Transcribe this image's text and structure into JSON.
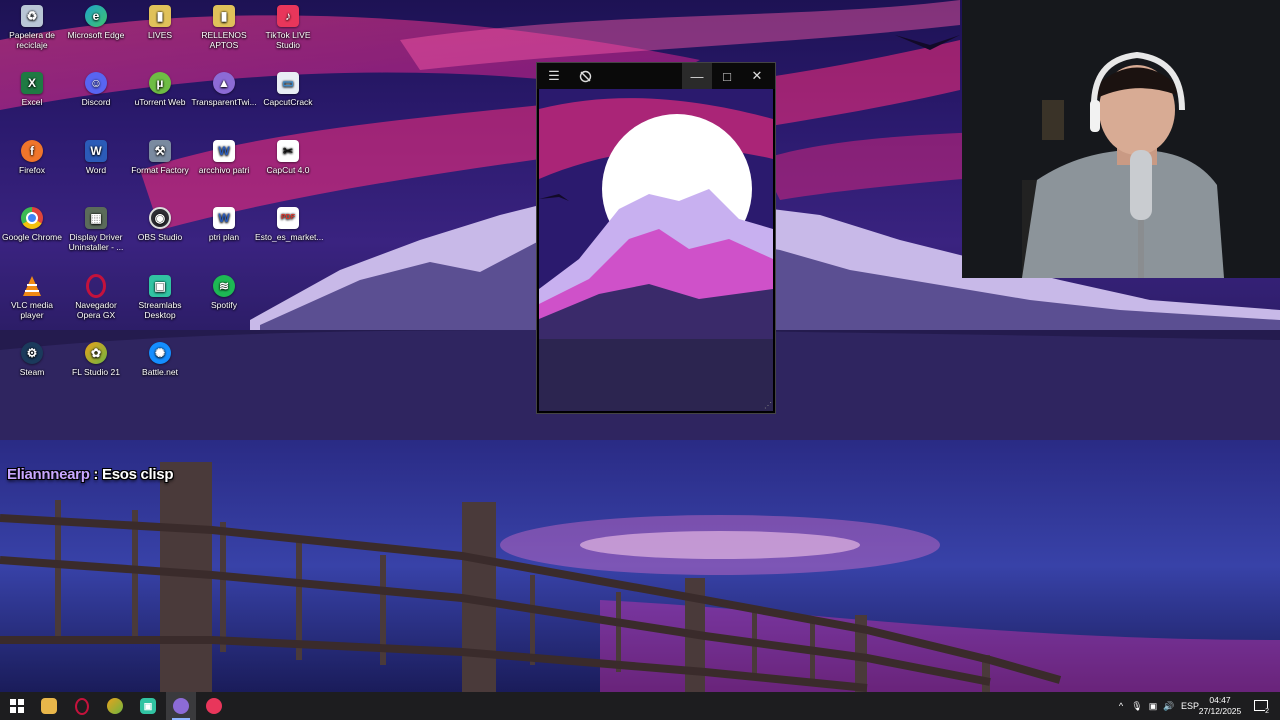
{
  "desktop": {
    "icons": [
      {
        "label": "Papelera de reciclaje",
        "icon": "recycle-bin-icon",
        "color": "#b9c6d6"
      },
      {
        "label": "Microsoft Edge",
        "icon": "edge-icon",
        "color": "#1fa3c9"
      },
      {
        "label": "LIVES",
        "icon": "folder-icon",
        "color": "#e0c15a"
      },
      {
        "label": "RELLENOS APTOS",
        "icon": "folder-icon",
        "color": "#e0c15a"
      },
      {
        "label": "TikTok LIVE Studio",
        "icon": "tiktok-live-icon",
        "color": "#e8365b"
      },
      {
        "label": "Excel",
        "icon": "excel-icon",
        "color": "#1f7a43"
      },
      {
        "label": "Discord",
        "icon": "discord-icon",
        "color": "#5865f2"
      },
      {
        "label": "uTorrent Web",
        "icon": "utorrent-icon",
        "color": "#6ebd44"
      },
      {
        "label": "TransparentTwi...",
        "icon": "twitch-icon",
        "color": "#8c6bd6"
      },
      {
        "label": "CapcutCrack",
        "icon": "app-icon",
        "color": "#3e8ed0"
      },
      {
        "label": "Firefox",
        "icon": "firefox-icon",
        "color": "#f0752b"
      },
      {
        "label": "Word",
        "icon": "word-icon",
        "color": "#2b5bb8"
      },
      {
        "label": "Format Factory",
        "icon": "format-factory-icon",
        "color": "#7a8aa0"
      },
      {
        "label": "arcchivo patri",
        "icon": "word-doc-icon",
        "color": "#2b5bb8"
      },
      {
        "label": "CapCut 4.0",
        "icon": "capcut-icon",
        "color": "#111111"
      },
      {
        "label": "Google Chrome",
        "icon": "chrome-icon",
        "color": "#e0443a"
      },
      {
        "label": "Display Driver Uninstaller - ...",
        "icon": "ddu-icon",
        "color": "#5b6b5a"
      },
      {
        "label": "OBS Studio",
        "icon": "obs-icon",
        "color": "#2d2d33"
      },
      {
        "label": "ptri plan",
        "icon": "word-doc-icon",
        "color": "#2b5bb8"
      },
      {
        "label": "Esto_es_market...",
        "icon": "pdf-icon",
        "color": "#d9352b"
      },
      {
        "label": "VLC media player",
        "icon": "vlc-icon",
        "color": "#f08a14"
      },
      {
        "label": "Navegador Opera GX",
        "icon": "opera-gx-icon",
        "color": "#c4123c"
      },
      {
        "label": "Streamlabs Desktop",
        "icon": "streamlabs-icon",
        "color": "#31c3a2"
      },
      {
        "label": "Spotify",
        "icon": "spotify-icon",
        "color": "#1db954"
      },
      {
        "label": "Steam",
        "icon": "steam-icon",
        "color": "#1b3a5c"
      },
      {
        "label": "FL Studio 21",
        "icon": "fl-studio-icon",
        "color": "#e8a21c"
      },
      {
        "label": "Battle.net",
        "icon": "battlenet-icon",
        "color": "#148eff"
      }
    ]
  },
  "app_window": {
    "menu_icon": "hamburger-menu-icon",
    "toggle_icon": "eye-off-icon",
    "minimize": "—",
    "maximize": "□",
    "close": "✕"
  },
  "chat": {
    "username": "Eliannnearp",
    "separator": " : ",
    "message": "Esos clisp"
  },
  "taskbar": {
    "start_icon": "windows-start-icon",
    "apps": [
      {
        "name": "file-explorer",
        "icon": "folder-icon",
        "color": "#e8b64a"
      },
      {
        "name": "opera-gx",
        "icon": "opera-gx-icon",
        "color": "#c4123c"
      },
      {
        "name": "fl-studio",
        "icon": "fl-studio-icon",
        "color": "#e8a21c"
      },
      {
        "name": "streamlabs",
        "icon": "streamlabs-icon",
        "color": "#31c3a2"
      },
      {
        "name": "transparent-twitch",
        "icon": "twitch-icon",
        "color": "#8c6bd6"
      },
      {
        "name": "tiktok-live",
        "icon": "tiktok-live-icon",
        "color": "#e8365b"
      }
    ],
    "tray": {
      "chevron": "^",
      "language": "ESP",
      "time": "04:47",
      "date": "27/12/2025",
      "notifications": "2"
    }
  }
}
